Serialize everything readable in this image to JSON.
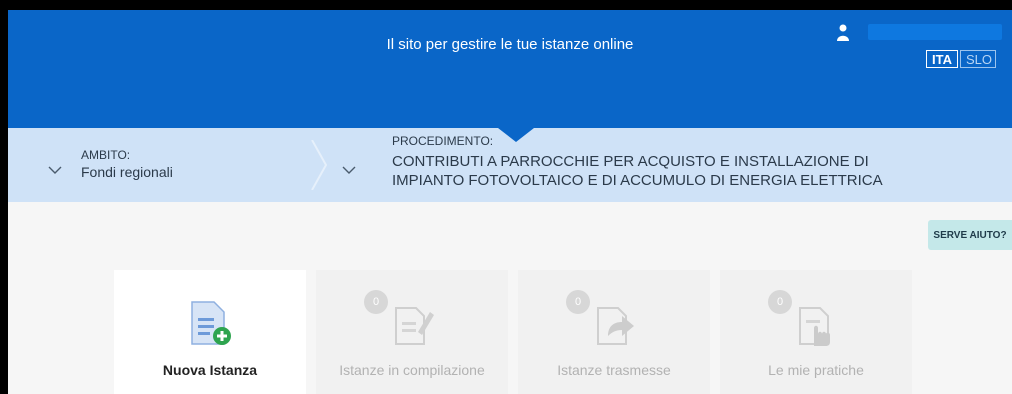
{
  "header": {
    "tagline": "Il sito per gestire le tue istanze online",
    "languages": [
      "ITA",
      "SLO"
    ],
    "active_language": "ITA"
  },
  "scope": {
    "ambito_label": "AMBITO:",
    "ambito_value": "Fondi regionali",
    "procedimento_label": "PROCEDIMENTO:",
    "procedimento_value": "CONTRIBUTI A PARROCCHIE PER ACQUISTO E INSTALLAZIONE DI IMPIANTO FOTOVOLTAICO E DI ACCUMULO DI ENERGIA ELETTRICA"
  },
  "help": {
    "label": "SERVE AIUTO?"
  },
  "cards": [
    {
      "title": "Nuova Istanza",
      "icon": "new-document-icon"
    },
    {
      "title": "Istanze in compilazione",
      "count": "0",
      "icon": "edit-document-icon"
    },
    {
      "title": "Istanze trasmesse",
      "count": "0",
      "icon": "send-document-icon"
    },
    {
      "title": "Le mie pratiche",
      "count": "0",
      "icon": "hand-document-icon"
    }
  ],
  "colors": {
    "header_blue": "#0a66c8",
    "band_blue": "#cfe2f7",
    "help_teal": "#c4e8e9",
    "icon_blue": "#5b8fd6",
    "icon_green": "#2ea44f"
  }
}
